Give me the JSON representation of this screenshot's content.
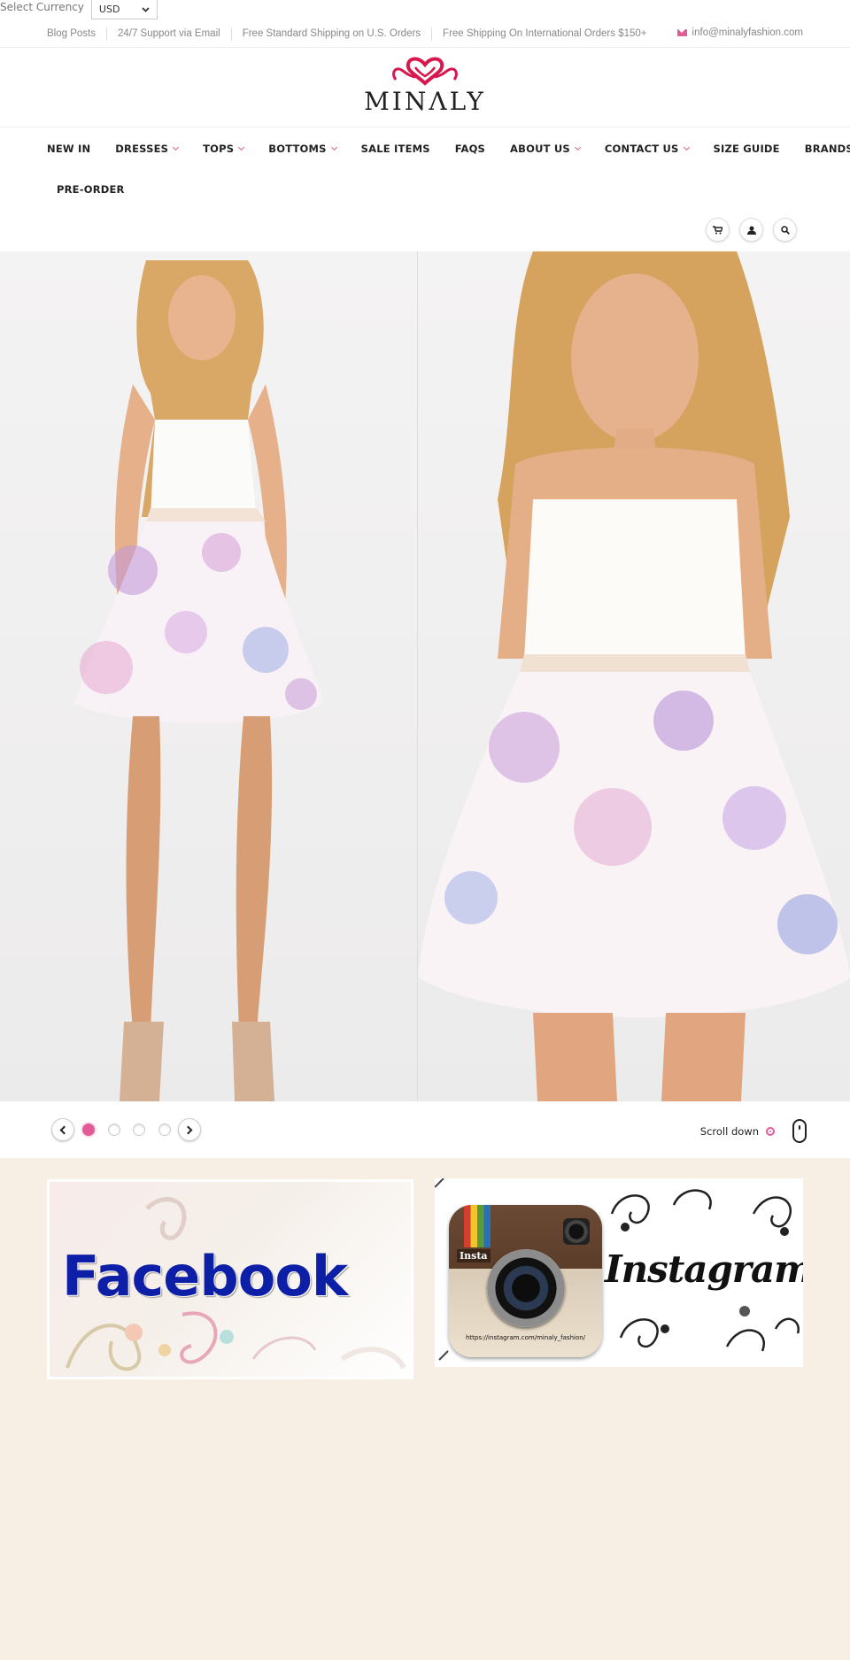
{
  "currency": {
    "label": "Select Currency",
    "value": "USD"
  },
  "topbar": {
    "links": [
      "Blog Posts",
      "24/7 Support via Email",
      "Free Standard Shipping on U.S. Orders",
      "Free Shipping On International Orders $150+"
    ],
    "email": "info@minalyfashion.com"
  },
  "logo": {
    "brand": "MINΛLY",
    "accent": "#d6184f"
  },
  "nav": {
    "items": [
      {
        "label": "NEW IN",
        "dropdown": false
      },
      {
        "label": "DRESSES",
        "dropdown": true
      },
      {
        "label": "TOPS",
        "dropdown": true
      },
      {
        "label": "BOTTOMS",
        "dropdown": true
      },
      {
        "label": "SALE ITEMS",
        "dropdown": false
      },
      {
        "label": "FAQS",
        "dropdown": false
      },
      {
        "label": "ABOUT US",
        "dropdown": true
      },
      {
        "label": "CONTACT US",
        "dropdown": true
      },
      {
        "label": "SIZE GUIDE",
        "dropdown": false
      },
      {
        "label": "BRANDS",
        "dropdown": false
      }
    ],
    "row2": "PRE-ORDER"
  },
  "icons": [
    "cart-icon",
    "user-icon",
    "search-icon"
  ],
  "slider": {
    "slides": 4,
    "active": 1,
    "scroll_label": "Scroll down"
  },
  "social": {
    "facebook_text": "Facebook",
    "instagram_text": "Instagram",
    "instagram_badge": "Insta",
    "instagram_url": "https://instagram.com/minaly_fashion/"
  },
  "colors": {
    "accent": "#e25b97",
    "lower_bg": "#f7eee4",
    "facebook": "#0e1fa7"
  }
}
